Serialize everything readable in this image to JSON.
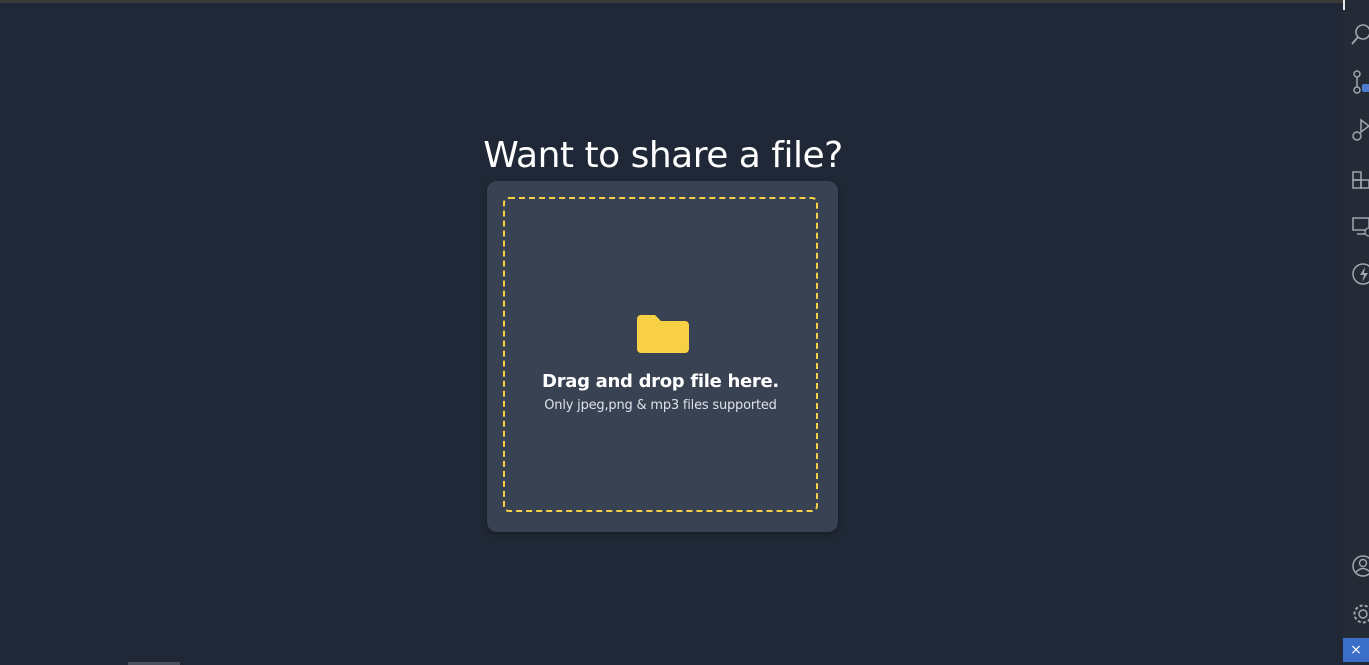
{
  "main": {
    "title": "Want to share a file?",
    "dropzone": {
      "icon": "folder-icon",
      "heading": "Drag and drop file here.",
      "subtext": "Only jpeg,png & mp3 files supported"
    }
  },
  "activity_bar": {
    "items": [
      {
        "icon": "search-icon"
      },
      {
        "icon": "source-control-icon"
      },
      {
        "icon": "run-debug-icon"
      },
      {
        "icon": "extensions-icon"
      },
      {
        "icon": "remote-explorer-icon"
      },
      {
        "icon": "thunder-icon"
      }
    ],
    "bottom_items": [
      {
        "icon": "account-icon"
      },
      {
        "icon": "manage-gear-icon"
      }
    ],
    "remote_indicator": "⨯"
  },
  "colors": {
    "background": "#202837",
    "card": "#394253",
    "accent": "#f7d046",
    "remote": "#3b6ec6"
  }
}
